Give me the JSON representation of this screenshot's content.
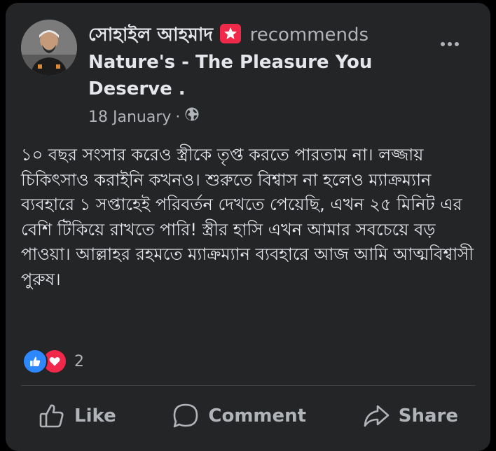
{
  "post": {
    "author": "সোহাইল আহমাদ",
    "badge_icon": "star-badge-icon",
    "action_text": "recommends",
    "page_name": "Nature's - The Pleasure You Deserve .",
    "date": "18 January",
    "separator": "·",
    "privacy_icon": "globe-icon",
    "more_icon": "more-options-icon",
    "body": "১০ বছর সংসার করেও স্ত্রীকে তৃপ্ত করতে পারতাম না। লজ্জায় চিকিৎসাও করাইনি কখনও। শুরুতে বিশ্বাস না হলেও ম্যাক্রম্যান ব্যবহারে ১ সপ্তাহেই পরিবর্তন দেখতে পেয়েছি, এখন ২৫ মিনিট এর বেশি টিকিয়ে রাখতে পারি! স্ত্রীর হাসি এখন আমার সবচেয়ে বড় পাওয়া। আল্লাহর রহমতে ম্যাক্রম্যান ব্যবহারে আজ আমি আত্মবিশ্বাসী পুরুষ।",
    "reaction_count": "2",
    "reactions": [
      "like-reaction-icon",
      "love-reaction-icon"
    ]
  },
  "actions": {
    "like_label": "Like",
    "comment_label": "Comment",
    "share_label": "Share"
  },
  "colors": {
    "card_bg": "#242526",
    "primary_text": "#e4e6eb",
    "secondary_text": "#b0b3b8",
    "like_blue": "#2d88ff",
    "love_red": "#f0284a"
  }
}
